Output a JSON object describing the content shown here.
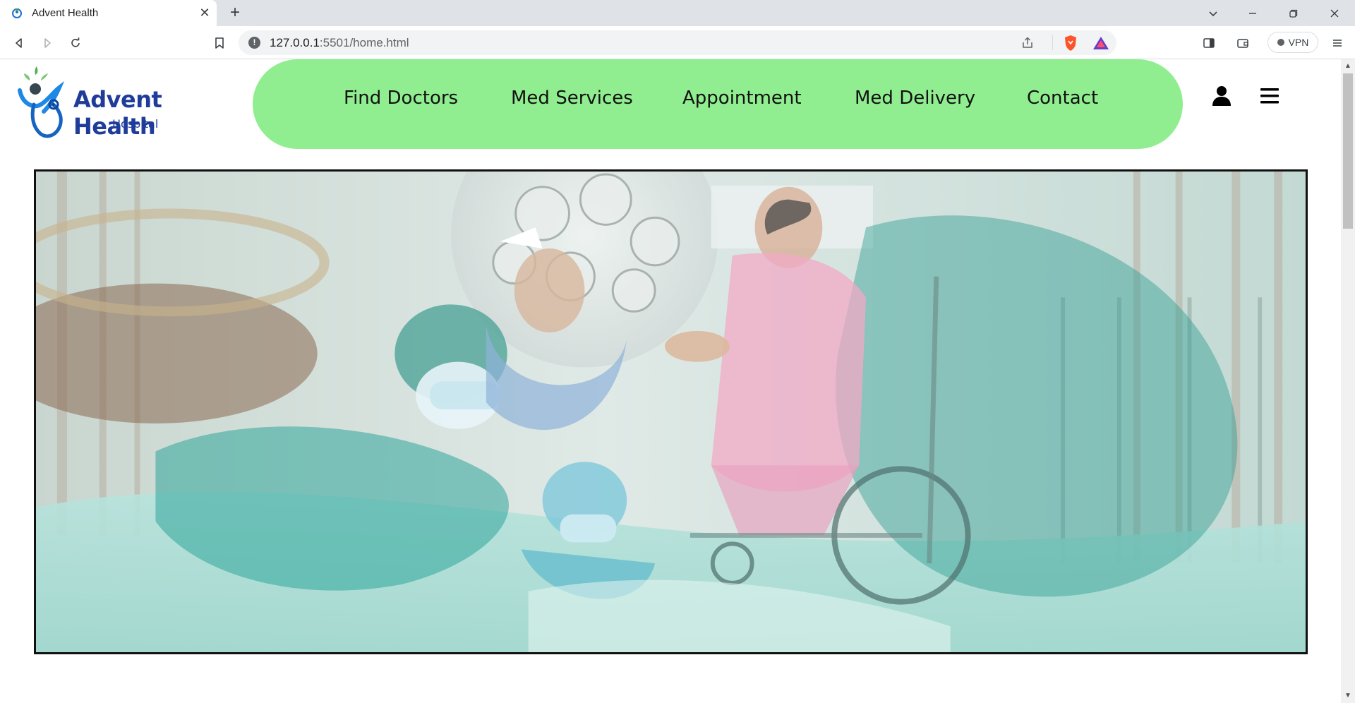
{
  "browser": {
    "tab_title": "Advent Health",
    "url_host": "127.0.0.1",
    "url_rest": ":5501/home.html",
    "vpn_label": "VPN"
  },
  "site": {
    "brand_name": "Advent Health",
    "brand_sub": "Hospital",
    "nav": [
      {
        "label": "Find Doctors"
      },
      {
        "label": "Med Services"
      },
      {
        "label": "Appointment"
      },
      {
        "label": "Med Delivery"
      },
      {
        "label": "Contact"
      }
    ],
    "nav_color": "#90ee90",
    "brand_color": "#1f3c9a"
  },
  "icons": {
    "user": "user-icon",
    "menu": "hamburger-menu-icon"
  }
}
